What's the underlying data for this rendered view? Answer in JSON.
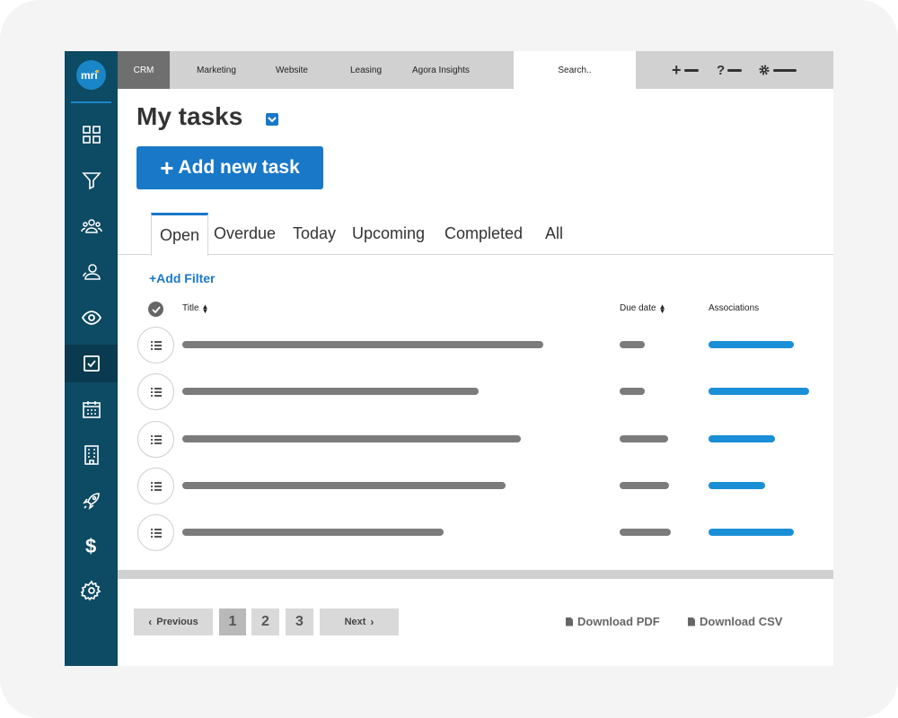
{
  "logo": {
    "text": "mri"
  },
  "sidebar": {
    "items": [
      {
        "name": "dashboard",
        "icon": "grid-icon"
      },
      {
        "name": "filter",
        "icon": "filter-icon"
      },
      {
        "name": "groups",
        "icon": "people-icon"
      },
      {
        "name": "contacts",
        "icon": "person-icon"
      },
      {
        "name": "views",
        "icon": "eye-icon"
      },
      {
        "name": "tasks",
        "icon": "checkbox-icon",
        "active": true
      },
      {
        "name": "calendar",
        "icon": "calendar-icon"
      },
      {
        "name": "buildings",
        "icon": "building-icon"
      },
      {
        "name": "launch",
        "icon": "rocket-icon"
      },
      {
        "name": "billing",
        "icon": "dollar-icon"
      },
      {
        "name": "settings",
        "icon": "gear-icon"
      }
    ]
  },
  "topnav": {
    "items": [
      "CRM",
      "Marketing",
      "Website",
      "Leasing",
      "Agora Insights"
    ],
    "active": "CRM",
    "search_placeholder": "Search..",
    "tools": [
      "plus-icon",
      "help-icon",
      "settings-icon"
    ]
  },
  "page": {
    "title": "My tasks",
    "add_button": "Add new task",
    "add_button_icon": "+"
  },
  "tabs": [
    "Open",
    "Overdue",
    "Today",
    "Upcoming",
    "Completed",
    "All"
  ],
  "filter": {
    "add_label": "+Add Filter"
  },
  "table": {
    "columns": {
      "title": "Title",
      "due": "Due date",
      "associations": "Associations"
    },
    "rows": [
      {
        "title_placeholder": true,
        "due_placeholder": true,
        "assoc_placeholder": true
      },
      {
        "title_placeholder": true,
        "due_placeholder": true,
        "assoc_placeholder": true
      },
      {
        "title_placeholder": true,
        "due_placeholder": true,
        "assoc_placeholder": true
      },
      {
        "title_placeholder": true,
        "due_placeholder": true,
        "assoc_placeholder": true
      },
      {
        "title_placeholder": true,
        "due_placeholder": true,
        "assoc_placeholder": true
      }
    ]
  },
  "pagination": {
    "previous": "Previous",
    "pages": [
      "1",
      "2",
      "3"
    ],
    "current": "1",
    "next": "Next"
  },
  "downloads": {
    "pdf": "Download PDF",
    "csv": "Download CSV"
  },
  "colors": {
    "sidebar": "#0d4a63",
    "accent": "#1a78c8",
    "topbar": "#d1d1d1",
    "placeholder_gray": "#7b7b7b",
    "placeholder_blue": "#1a8fd6"
  }
}
